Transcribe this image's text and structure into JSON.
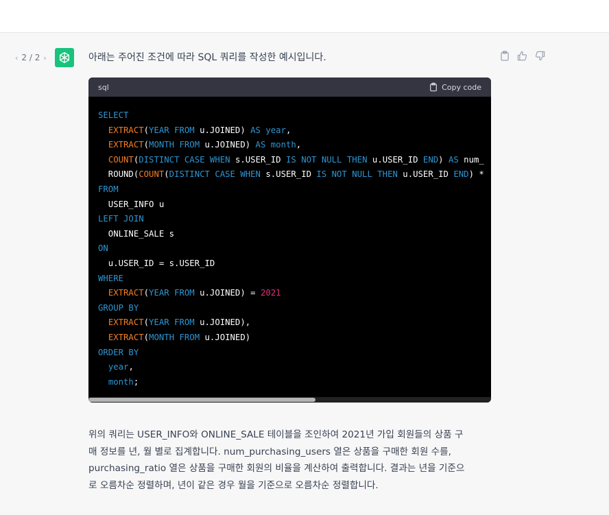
{
  "pager": {
    "label": "2 / 2",
    "prev": "‹",
    "next": "›"
  },
  "colors": {
    "accent": "#19c37d",
    "keyword": "#2e95d3",
    "function": "#f37e28",
    "number": "#df3079"
  },
  "message": {
    "intro": "아래는 주어진 조건에 따라 SQL 쿼리를 작성한 예시입니다.",
    "code_block": {
      "language": "sql",
      "copy_label": "Copy code",
      "lines": [
        [
          {
            "t": "kw",
            "v": "SELECT"
          }
        ],
        [
          {
            "t": "p",
            "v": "  "
          },
          {
            "t": "fn",
            "v": "EXTRACT"
          },
          {
            "t": "p",
            "v": "("
          },
          {
            "t": "kw",
            "v": "YEAR"
          },
          {
            "t": "p",
            "v": " "
          },
          {
            "t": "kw",
            "v": "FROM"
          },
          {
            "t": "p",
            "v": " u.JOINED) "
          },
          {
            "t": "kw",
            "v": "AS"
          },
          {
            "t": "p",
            "v": " "
          },
          {
            "t": "kw",
            "v": "year"
          },
          {
            "t": "p",
            "v": ","
          }
        ],
        [
          {
            "t": "p",
            "v": "  "
          },
          {
            "t": "fn",
            "v": "EXTRACT"
          },
          {
            "t": "p",
            "v": "("
          },
          {
            "t": "kw",
            "v": "MONTH"
          },
          {
            "t": "p",
            "v": " "
          },
          {
            "t": "kw",
            "v": "FROM"
          },
          {
            "t": "p",
            "v": " u.JOINED) "
          },
          {
            "t": "kw",
            "v": "AS"
          },
          {
            "t": "p",
            "v": " "
          },
          {
            "t": "kw",
            "v": "month"
          },
          {
            "t": "p",
            "v": ","
          }
        ],
        [
          {
            "t": "p",
            "v": "  "
          },
          {
            "t": "fn",
            "v": "COUNT"
          },
          {
            "t": "p",
            "v": "("
          },
          {
            "t": "kw",
            "v": "DISTINCT"
          },
          {
            "t": "p",
            "v": " "
          },
          {
            "t": "kw",
            "v": "CASE"
          },
          {
            "t": "p",
            "v": " "
          },
          {
            "t": "kw",
            "v": "WHEN"
          },
          {
            "t": "p",
            "v": " s.USER_ID "
          },
          {
            "t": "kw",
            "v": "IS"
          },
          {
            "t": "p",
            "v": " "
          },
          {
            "t": "kw",
            "v": "NOT"
          },
          {
            "t": "p",
            "v": " "
          },
          {
            "t": "kw",
            "v": "NULL"
          },
          {
            "t": "p",
            "v": " "
          },
          {
            "t": "kw",
            "v": "THEN"
          },
          {
            "t": "p",
            "v": " u.USER_ID "
          },
          {
            "t": "kw",
            "v": "END"
          },
          {
            "t": "p",
            "v": ") "
          },
          {
            "t": "kw",
            "v": "AS"
          },
          {
            "t": "p",
            "v": " num_"
          }
        ],
        [
          {
            "t": "p",
            "v": "  ROUND("
          },
          {
            "t": "fn",
            "v": "COUNT"
          },
          {
            "t": "p",
            "v": "("
          },
          {
            "t": "kw",
            "v": "DISTINCT"
          },
          {
            "t": "p",
            "v": " "
          },
          {
            "t": "kw",
            "v": "CASE"
          },
          {
            "t": "p",
            "v": " "
          },
          {
            "t": "kw",
            "v": "WHEN"
          },
          {
            "t": "p",
            "v": " s.USER_ID "
          },
          {
            "t": "kw",
            "v": "IS"
          },
          {
            "t": "p",
            "v": " "
          },
          {
            "t": "kw",
            "v": "NOT"
          },
          {
            "t": "p",
            "v": " "
          },
          {
            "t": "kw",
            "v": "NULL"
          },
          {
            "t": "p",
            "v": " "
          },
          {
            "t": "kw",
            "v": "THEN"
          },
          {
            "t": "p",
            "v": " u.USER_ID "
          },
          {
            "t": "kw",
            "v": "END"
          },
          {
            "t": "p",
            "v": ") *"
          }
        ],
        [
          {
            "t": "kw",
            "v": "FROM"
          }
        ],
        [
          {
            "t": "p",
            "v": "  USER_INFO u"
          }
        ],
        [
          {
            "t": "kw",
            "v": "LEFT JOIN"
          }
        ],
        [
          {
            "t": "p",
            "v": "  ONLINE_SALE s"
          }
        ],
        [
          {
            "t": "kw",
            "v": "ON"
          }
        ],
        [
          {
            "t": "p",
            "v": "  u.USER_ID = s.USER_ID"
          }
        ],
        [
          {
            "t": "kw",
            "v": "WHERE"
          }
        ],
        [
          {
            "t": "p",
            "v": "  "
          },
          {
            "t": "fn",
            "v": "EXTRACT"
          },
          {
            "t": "p",
            "v": "("
          },
          {
            "t": "kw",
            "v": "YEAR"
          },
          {
            "t": "p",
            "v": " "
          },
          {
            "t": "kw",
            "v": "FROM"
          },
          {
            "t": "p",
            "v": " u.JOINED) = "
          },
          {
            "t": "num",
            "v": "2021"
          }
        ],
        [
          {
            "t": "kw",
            "v": "GROUP BY"
          }
        ],
        [
          {
            "t": "p",
            "v": "  "
          },
          {
            "t": "fn",
            "v": "EXTRACT"
          },
          {
            "t": "p",
            "v": "("
          },
          {
            "t": "kw",
            "v": "YEAR"
          },
          {
            "t": "p",
            "v": " "
          },
          {
            "t": "kw",
            "v": "FROM"
          },
          {
            "t": "p",
            "v": " u.JOINED),"
          }
        ],
        [
          {
            "t": "p",
            "v": "  "
          },
          {
            "t": "fn",
            "v": "EXTRACT"
          },
          {
            "t": "p",
            "v": "("
          },
          {
            "t": "kw",
            "v": "MONTH"
          },
          {
            "t": "p",
            "v": " "
          },
          {
            "t": "kw",
            "v": "FROM"
          },
          {
            "t": "p",
            "v": " u.JOINED)"
          }
        ],
        [
          {
            "t": "kw",
            "v": "ORDER BY"
          }
        ],
        [
          {
            "t": "p",
            "v": "  "
          },
          {
            "t": "kw",
            "v": "year"
          },
          {
            "t": "p",
            "v": ","
          }
        ],
        [
          {
            "t": "p",
            "v": "  "
          },
          {
            "t": "kw",
            "v": "month"
          },
          {
            "t": "p",
            "v": ";"
          }
        ]
      ]
    },
    "explanation_lines": [
      "위의 쿼리는 USER_INFO와 ONLINE_SALE 테이블을 조인하여 2021년 가입 회원들의 상품 구",
      "매 정보를 년, 월 별로 집계합니다. num_purchasing_users 열은 상품을 구매한 회원 수를,",
      "purchasing_ratio 열은 상품을 구매한 회원의 비율을 계산하여 출력합니다. 결과는 년을 기준으",
      "로 오름차순 정렬하며, 년이 같은 경우 월을 기준으로 오름차순 정렬합니다."
    ]
  }
}
